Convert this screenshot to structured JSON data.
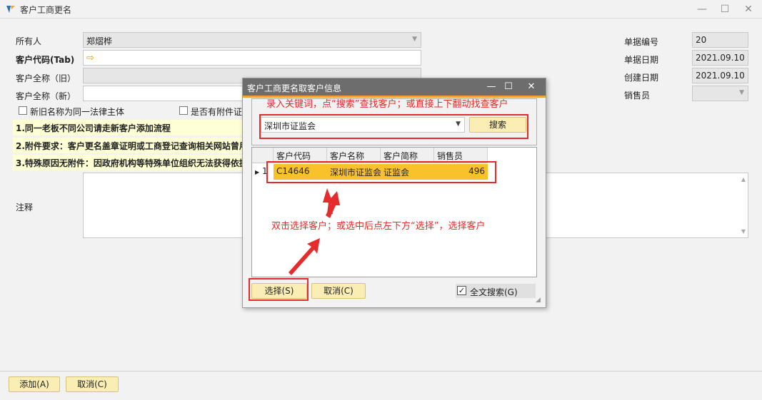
{
  "window": {
    "title": "客户工商更名"
  },
  "form": {
    "owner_label": "所有人",
    "owner_value": "郑熠桦",
    "code_label": "客户代码(Tab)",
    "oldname_label": "客户全称（旧）",
    "newname_label": "客户全称（新）",
    "same_entity_label": "新旧名称为同一法律主体",
    "attach_label": "是否有附件证",
    "note1": "1.同一老板不同公司请走新客户添加流程",
    "note2": "2.附件要求：客户更名盖章证明或工商登记查询相关网站曾用",
    "note3": "3.特殊原因无附件：因政府机构等特殊单位组织无法获得依据",
    "remark_label": "注释",
    "docno_label": "单据编号",
    "docno_value": "20",
    "docdate_label": "单据日期",
    "docdate_value": "2021.09.10",
    "created_label": "创建日期",
    "created_value": "2021.09.10",
    "sales_label": "销售员"
  },
  "footer": {
    "add_label": "添加(A)",
    "cancel_label": "取消(C)"
  },
  "dialog": {
    "title": "客户工商更名取客户信息",
    "search_value": "深圳市证监会",
    "search_button": "搜索",
    "columns": [
      "客户代码",
      "客户名称",
      "客户简称",
      "销售员"
    ],
    "row": {
      "indicator": "1",
      "code": "C14646",
      "name": "深圳市证监会",
      "short": "证监会",
      "sales": "496"
    },
    "select_button": "选择(S)",
    "cancel_button": "取消(C)",
    "fulltext_label": "全文搜索(G)"
  },
  "annotations": {
    "top": "录入关键词，点“搜索”查找客户；或直接上下翻动找查客户",
    "middle": "双击选择客户；或选中后点左下方“选择”，选择客户"
  },
  "colors": {
    "accent": "#f9c22b",
    "annotation": "#e52b2b",
    "dialog_title": "#6d6d6d"
  }
}
